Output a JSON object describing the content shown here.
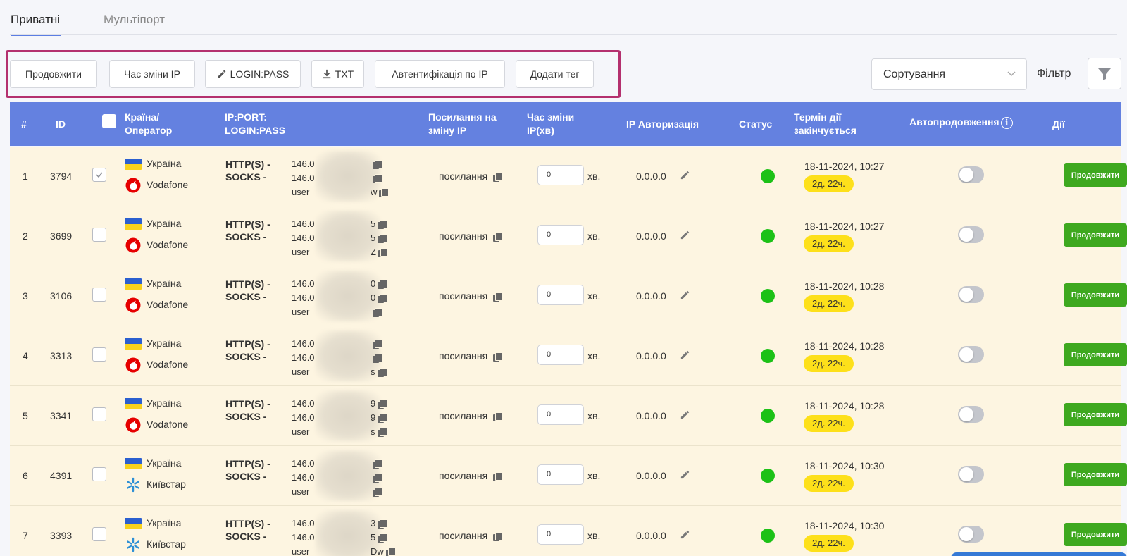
{
  "tabs": [
    {
      "label": "Приватні",
      "active": true
    },
    {
      "label": "Мультіпорт",
      "active": false
    }
  ],
  "toolbar": {
    "buttons": [
      {
        "label": "Продовжити",
        "icon": ""
      },
      {
        "label": "Час зміни IP",
        "icon": ""
      },
      {
        "label": "LOGIN:PASS",
        "icon": "pencil-icon"
      },
      {
        "label": "TXT",
        "icon": "download-icon"
      },
      {
        "label": "Автентифікація по IP",
        "icon": ""
      },
      {
        "label": "Додати тег",
        "icon": ""
      }
    ],
    "sort_label": "Сортування",
    "filter_label": "Фільтр"
  },
  "table": {
    "headers": {
      "num": "#",
      "id": "ID",
      "country_line1": "Країна/",
      "country_line2": "Оператор",
      "ip_line1": "IP:PORT:",
      "ip_line2": "LOGIN:PASS",
      "link_line1": "Посилання на",
      "link_line2": "зміну IP",
      "time_line1": "Час зміни",
      "time_line2": "IP(хв)",
      "ipauth": "IP Авторизація",
      "status": "Статус",
      "expire_line1": "Термін дії",
      "expire_line2": "закінчується",
      "autorenew": "Автопродовження",
      "info_icon": "i",
      "actions": "Дії"
    },
    "rows": [
      {
        "num": "1",
        "id": "3794",
        "checked": true,
        "country": "Україна",
        "operator": "Vodafone",
        "operator_icon": "vodafone-icon",
        "proto1": "HTTP(S) -",
        "proto2": "SOCKS -",
        "ip1": "146.0",
        "ip2": "146.0",
        "ip3": "user",
        "suf1": "",
        "suf2": "",
        "suf3": "w",
        "link": "посилання",
        "time": "0",
        "unit": "хв.",
        "ipauth": "0.0.0.0",
        "expire": "18-11-2024, 10:27",
        "badge": "2д. 22ч.",
        "renew": "Продовжити"
      },
      {
        "num": "2",
        "id": "3699",
        "checked": false,
        "country": "Україна",
        "operator": "Vodafone",
        "operator_icon": "vodafone-icon",
        "proto1": "HTTP(S) -",
        "proto2": "SOCKS -",
        "ip1": "146.0",
        "ip2": "146.0",
        "ip3": "user",
        "suf1": "5",
        "suf2": "5",
        "suf3": "Z",
        "link": "посилання",
        "time": "0",
        "unit": "хв.",
        "ipauth": "0.0.0.0",
        "expire": "18-11-2024, 10:27",
        "badge": "2д. 22ч.",
        "renew": "Продовжити"
      },
      {
        "num": "3",
        "id": "3106",
        "checked": false,
        "country": "Україна",
        "operator": "Vodafone",
        "operator_icon": "vodafone-icon",
        "proto1": "HTTP(S) -",
        "proto2": "SOCKS -",
        "ip1": "146.0",
        "ip2": "146.0",
        "ip3": "user",
        "suf1": "0",
        "suf2": "0",
        "suf3": "",
        "link": "посилання",
        "time": "0",
        "unit": "хв.",
        "ipauth": "0.0.0.0",
        "expire": "18-11-2024, 10:28",
        "badge": "2д. 22ч.",
        "renew": "Продовжити"
      },
      {
        "num": "4",
        "id": "3313",
        "checked": false,
        "country": "Україна",
        "operator": "Vodafone",
        "operator_icon": "vodafone-icon",
        "proto1": "HTTP(S) -",
        "proto2": "SOCKS -",
        "ip1": "146.0",
        "ip2": "146.0",
        "ip3": "user",
        "suf1": "",
        "suf2": "",
        "suf3": "s",
        "link": "посилання",
        "time": "0",
        "unit": "хв.",
        "ipauth": "0.0.0.0",
        "expire": "18-11-2024, 10:28",
        "badge": "2д. 22ч.",
        "renew": "Продовжити"
      },
      {
        "num": "5",
        "id": "3341",
        "checked": false,
        "country": "Україна",
        "operator": "Vodafone",
        "operator_icon": "vodafone-icon",
        "proto1": "HTTP(S) -",
        "proto2": "SOCKS -",
        "ip1": "146.0",
        "ip2": "146.0",
        "ip3": "user",
        "suf1": "9",
        "suf2": "9",
        "suf3": "s",
        "link": "посилання",
        "time": "0",
        "unit": "хв.",
        "ipauth": "0.0.0.0",
        "expire": "18-11-2024, 10:28",
        "badge": "2д. 22ч.",
        "renew": "Продовжити"
      },
      {
        "num": "6",
        "id": "4391",
        "checked": false,
        "country": "Україна",
        "operator": "Київстар",
        "operator_icon": "kyivstar-icon",
        "proto1": "HTTP(S) -",
        "proto2": "SOCKS -",
        "ip1": "146.0",
        "ip2": "146.0",
        "ip3": "user",
        "suf1": "",
        "suf2": "",
        "suf3": "",
        "link": "посилання",
        "time": "0",
        "unit": "хв.",
        "ipauth": "0.0.0.0",
        "expire": "18-11-2024, 10:30",
        "badge": "2д. 22ч.",
        "renew": "Продовжити"
      },
      {
        "num": "7",
        "id": "3393",
        "checked": false,
        "country": "Україна",
        "operator": "Київстар",
        "operator_icon": "kyivstar-icon",
        "proto1": "HTTP(S) -",
        "proto2": "SOCKS -",
        "ip1": "146.0",
        "ip2": "146.0",
        "ip3": "user",
        "suf1": "3",
        "suf2": "5",
        "suf3": "Dw",
        "link": "посилання",
        "time": "0",
        "unit": "хв.",
        "ipauth": "0.0.0.0",
        "expire": "18-11-2024, 10:30",
        "badge": "2д. 22ч.",
        "renew": "Продовжити"
      }
    ]
  },
  "colors": {
    "header_bg": "#6481e0",
    "row_bg": "#fdf5e1",
    "status_active": "#1cc117",
    "renew_button": "#3ea81f",
    "badge": "#fde01a",
    "highlight_border": "#b4306e"
  }
}
